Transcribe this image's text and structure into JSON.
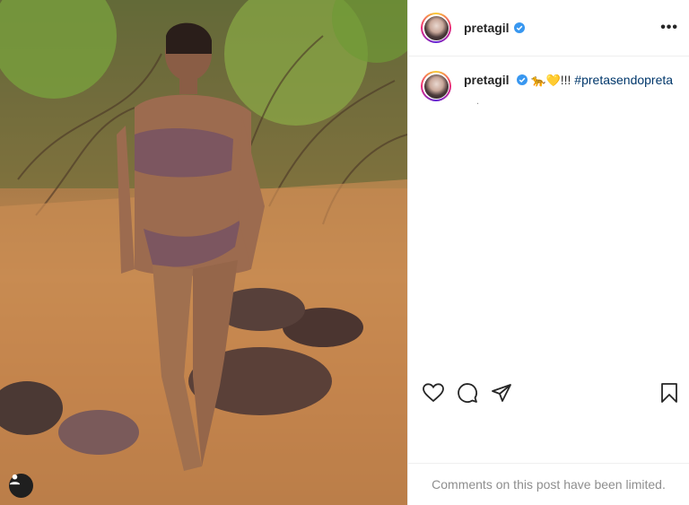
{
  "post": {
    "username": "pretagil",
    "more_label": "•••",
    "caption": {
      "username": "pretagil",
      "emojis": "🐆💛",
      "text": "!!! ",
      "hashtag": "#pretasendopreta",
      "sub": "."
    },
    "comments_notice": "Comments on this post have been limited."
  },
  "icons": {
    "verified": "verified-badge-icon",
    "like": "heart-icon",
    "comment": "comment-icon",
    "share": "paper-plane-icon",
    "save": "bookmark-icon",
    "tags": "user-tag-icon"
  },
  "colors": {
    "verified": "#3897f0",
    "text": "#262626",
    "muted": "#8e8e8e",
    "hashtag": "#00376b",
    "border": "#efefef"
  }
}
